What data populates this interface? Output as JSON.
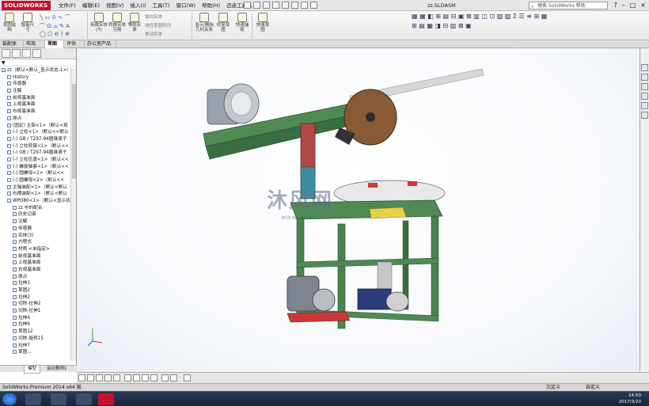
{
  "titlebar": {
    "logo": "SOLIDWORKS",
    "menus": [
      "文件(F)",
      "编辑(E)",
      "视图(V)",
      "插入(I)",
      "工具(T)",
      "窗口(W)",
      "帮助(H)",
      "迈迪工具集"
    ],
    "doc_title": "zz.SLDASM",
    "search_placeholder": "搜索 SolidWorks 帮助",
    "window_buttons": [
      "?",
      "–",
      "□",
      "×"
    ]
  },
  "ribbon": {
    "buttons": [
      {
        "label": "草图绘制"
      },
      {
        "label": "智能尺寸"
      },
      {
        "label": "剪裁实体(T)"
      },
      {
        "label": "转换实体引用"
      },
      {
        "label": "等距实体"
      },
      {
        "label": "线性草图阵列"
      },
      {
        "label": "显示/删除几何关系"
      },
      {
        "label": "修复草图"
      },
      {
        "label": "快速捕捉"
      },
      {
        "label": "快速草图"
      }
    ],
    "small_items": [
      "镜向实体",
      "线性草图阵列",
      "移动实体"
    ]
  },
  "command_tabs": [
    "装配体",
    "布局",
    "草图",
    "评估",
    "办公室产品"
  ],
  "active_tab": "草图",
  "tree": {
    "filter": "▼",
    "items": [
      "zz（默认<默认_显示状态-1>）",
      "History",
      "传感器",
      "注解",
      "前视基准面",
      "上视基准面",
      "右视基准面",
      "原点",
      "(固定) 主架<1>（默认<按",
      "(-) 立柱<1>（默认<<默认",
      "(-) GB / T297-94圆锥滚子",
      "(-) 立柱转臂<1>（默认<<",
      "(-) GB / T297-94圆锥滚子",
      "(-) 立柱压盖<1>（默认<<",
      "(-) 螺旋轴套<1>（默认<<",
      "(-) 圆螺母<1>（默认<<",
      "(-) 圆螺母<2>（默认<<",
      "主轴装配<1>（默认<默认",
      "右摆装配<1>（默认<默认",
      "WPO80<1>（默认<显示状",
      "zz 中的配合",
      "历史记录",
      "注解",
      "传感器",
      "实体(3)",
      "方程式",
      "材质 <未指定>",
      "前视基准面",
      "上视基准面",
      "右视基准面",
      "原点",
      "拉伸1",
      "草图2",
      "拉伸2",
      "切除-拉伸2",
      "切除-拉伸1",
      "拉伸4",
      "拉伸6",
      "草图12",
      "切除-旋转15",
      "拉伸7",
      "草图..."
    ]
  },
  "bottom_tabs": [
    "模型",
    "运动算例1"
  ],
  "watermark": {
    "title": "沐风网",
    "url": "www.mfcad.com"
  },
  "status": {
    "left": "SolidWorks Premium 2014 x64 版",
    "mid": "欠定义",
    "right": "自定义"
  },
  "clock": {
    "time": "14:50",
    "date": "2017/3/20"
  },
  "colors": {
    "frame_green": "#3f7a47",
    "wheel_brown": "#8a5a34",
    "motor_gray": "#9aa2ad",
    "blue_motor": "#2a3d7a",
    "red_parts": "#c83a3a",
    "ribbon_bg": "#eeeeee",
    "logo_red": "#c8102e"
  }
}
